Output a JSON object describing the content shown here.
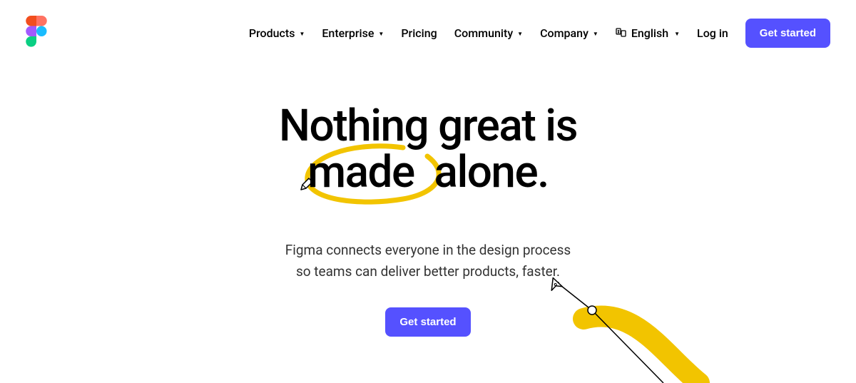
{
  "nav": {
    "products": "Products",
    "enterprise": "Enterprise",
    "pricing": "Pricing",
    "community": "Community",
    "company": "Company",
    "language": "English",
    "login": "Log in",
    "cta": "Get started"
  },
  "hero": {
    "headline_line1": "Nothing great is",
    "headline_word_made": "made",
    "headline_word_alone": "alone.",
    "subhead_line1": "Figma connects everyone in the design process",
    "subhead_line2": "so teams can deliver better products, faster.",
    "cta": "Get started"
  }
}
